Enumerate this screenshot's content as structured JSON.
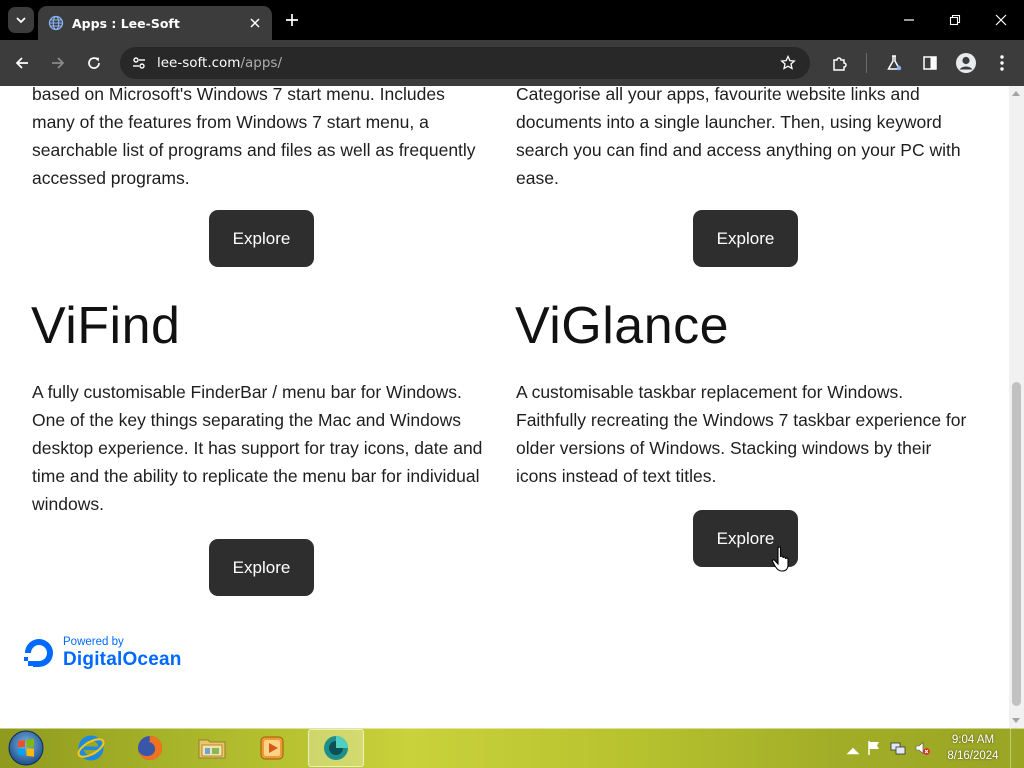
{
  "browser": {
    "tab": {
      "title": "Apps : Lee-Soft"
    },
    "address": {
      "host": "lee-soft.com",
      "path": "/apps/"
    }
  },
  "page": {
    "top_left_text": [
      "based on Microsoft's Windows 7 start menu. Includes",
      "many of the features from Windows 7 start menu, a",
      "searchable list of programs and files as well as frequently",
      "accessed programs."
    ],
    "top_right_text": [
      "Categorise all your apps, favourite website links and",
      "documents into a single launcher. Then, using keyword",
      "search you can find and access anything on your PC with",
      "ease."
    ],
    "explore_label": "Explore",
    "vifind": {
      "title": "ViFind",
      "description": [
        "A fully customisable FinderBar / menu bar for Windows.",
        "One of the key things separating the Mac and Windows",
        "desktop experience. It has support for tray icons, date and",
        "time and the ability to replicate the menu bar for individual",
        "windows."
      ]
    },
    "viglance": {
      "title": "ViGlance",
      "description": [
        "A customisable taskbar replacement for Windows.",
        "Faithfully recreating the Windows 7 taskbar experience for",
        "older versions of Windows. Stacking windows by their",
        "icons instead of text titles."
      ]
    },
    "footer": {
      "powered_by": "Powered by",
      "brand": "DigitalOcean"
    }
  },
  "taskbar": {
    "apps": [
      "internet-explorer",
      "firefox",
      "windows-explorer",
      "media-player",
      "viglance"
    ],
    "clock": {
      "time": "9:04 AM",
      "date": "8/16/2024"
    }
  }
}
